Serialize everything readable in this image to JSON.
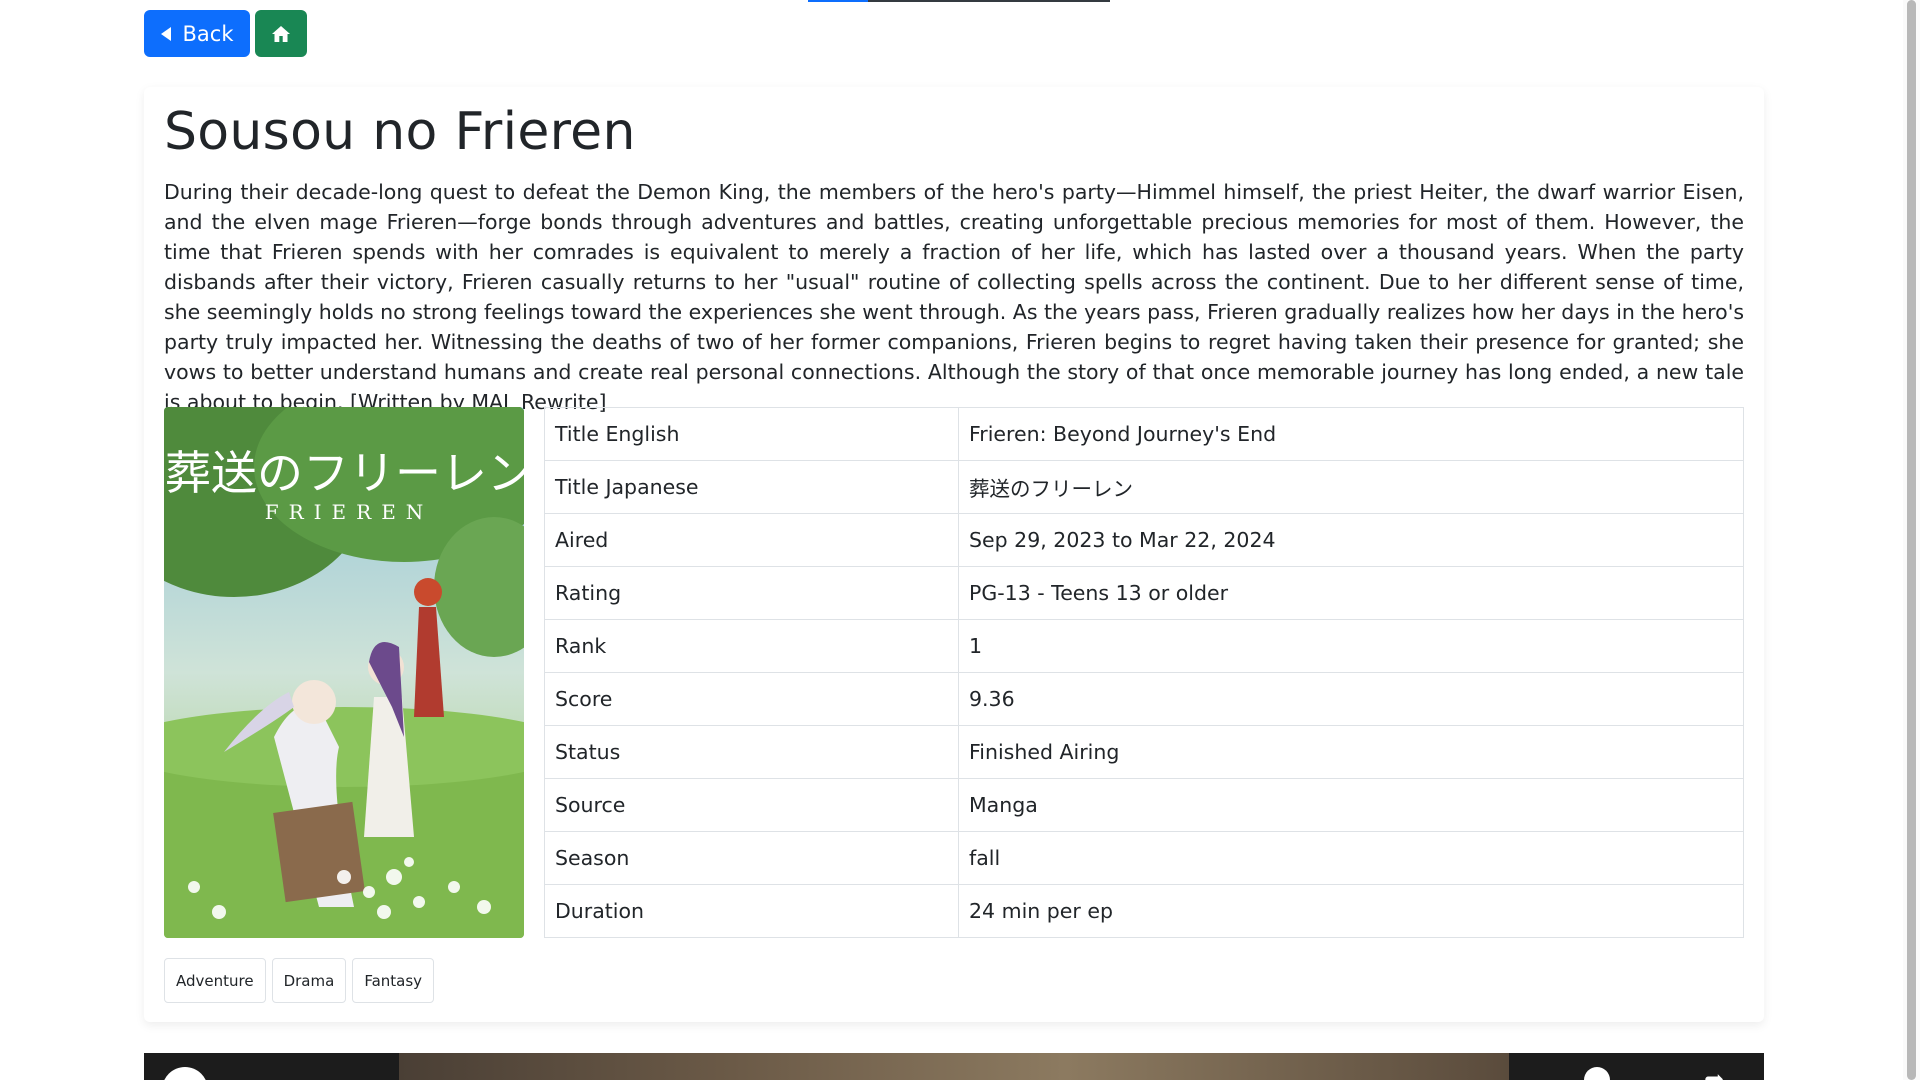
{
  "nav": {
    "back_label": "Back",
    "back_icon": "caret-left-icon",
    "home_icon": "house-icon"
  },
  "anime": {
    "title": "Sousou no Frieren",
    "synopsis": "During their decade-long quest to defeat the Demon King, the members of the hero's party—Himmel himself, the priest Heiter, the dwarf warrior Eisen, and the elven mage Frieren—forge bonds through adventures and battles, creating unforgettable precious memories for most of them. However, the time that Frieren spends with her comrades is equivalent to merely a fraction of her life, which has lasted over a thousand years. When the party disbands after their victory, Frieren casually returns to her \"usual\" routine of collecting spells across the continent. Due to her different sense of time, she seemingly holds no strong feelings toward the experiences she went through. As the years pass, Frieren gradually realizes how her days in the hero's party truly impacted her. Witnessing the deaths of two of her former companions, Frieren begins to regret having taken their presence for granted; she vows to better understand humans and create real personal connections. Although the story of that once memorable journey has long ended, a new tale is about to begin. [Written by MAL Rewrite]",
    "poster": {
      "title_jp": "葬送のフリーレン",
      "title_en": "FRIEREN"
    },
    "details": [
      {
        "label": "Title English",
        "value": "Frieren: Beyond Journey's End"
      },
      {
        "label": "Title Japanese",
        "value": "葬送のフリーレン"
      },
      {
        "label": "Aired",
        "value": "Sep 29, 2023 to Mar 22, 2024"
      },
      {
        "label": "Rating",
        "value": "PG-13 - Teens 13 or older"
      },
      {
        "label": "Rank",
        "value": "1"
      },
      {
        "label": "Score",
        "value": "9.36"
      },
      {
        "label": "Status",
        "value": "Finished Airing"
      },
      {
        "label": "Source",
        "value": "Manga"
      },
      {
        "label": "Season",
        "value": "fall"
      },
      {
        "label": "Duration",
        "value": "24 min per ep"
      }
    ],
    "genres": [
      "Adventure",
      "Drama",
      "Fantasy"
    ]
  },
  "colors": {
    "primary": "#0d6efd",
    "success": "#198754",
    "border": "#dee2e6",
    "text": "#212529"
  }
}
